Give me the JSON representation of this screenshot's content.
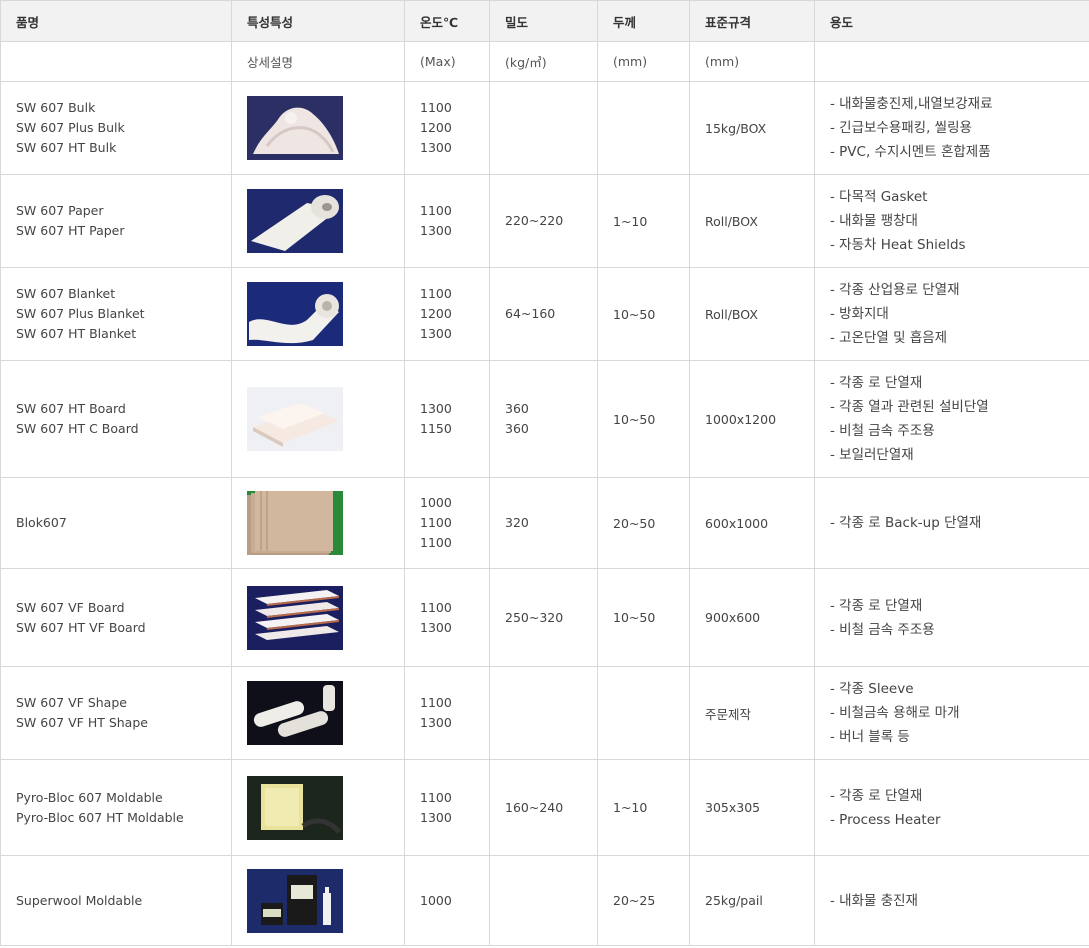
{
  "headers": [
    "품명",
    "특성특성",
    "온도℃",
    "밀도",
    "두께",
    "표준규격",
    "용도"
  ],
  "subheaders": [
    "",
    "상세설명",
    "(Max)",
    "(kg/㎥)",
    "(mm)",
    "(mm)",
    ""
  ],
  "rows": [
    {
      "names": [
        "SW 607 Bulk",
        "SW 607 Plus Bulk",
        "SW 607 HT Bulk"
      ],
      "image": "bulk-fiber-image",
      "temps": [
        "1100",
        "1200",
        "1300"
      ],
      "density": [],
      "thickness": "",
      "spec": "15kg/BOX",
      "uses": [
        "- 내화물충진제,내열보강재료",
        "- 긴급보수용패킹, 씰링용",
        "- PVC, 수지시멘트 혼합제품"
      ]
    },
    {
      "names": [
        "SW 607 Paper",
        "SW 607 HT Paper"
      ],
      "image": "paper-roll-image",
      "temps": [
        "1100",
        "1300"
      ],
      "density": [
        "220~220"
      ],
      "thickness": "1~10",
      "spec": "Roll/BOX",
      "uses": [
        "- 다목적 Gasket",
        "- 내화물 팽창대",
        "- 자동차 Heat Shields"
      ]
    },
    {
      "names": [
        "SW 607 Blanket",
        "SW 607 Plus Blanket",
        "SW 607 HT Blanket"
      ],
      "image": "blanket-roll-image",
      "temps": [
        "1100",
        "1200",
        "1300"
      ],
      "density": [
        "64~160"
      ],
      "thickness": "10~50",
      "spec": "Roll/BOX",
      "uses": [
        "- 각종 산업용로 단열재",
        "- 방화지대",
        "- 고온단열 및 흡음제"
      ]
    },
    {
      "names": [
        "SW 607 HT Board",
        "SW 607 HT C Board"
      ],
      "image": "board-sheets-image",
      "temps": [
        "1300",
        "1150"
      ],
      "density": [
        "360",
        "360"
      ],
      "thickness": "10~50",
      "spec": "1000x1200",
      "uses": [
        "- 각종 로 단열재",
        "- 각종 열과 관련된 설비단열",
        "- 비철 금속 주조용",
        "- 보일러단열재"
      ]
    },
    {
      "names": [
        "Blok607"
      ],
      "image": "blok-panels-image",
      "temps": [
        "1000",
        "1100",
        "1100"
      ],
      "density": [
        "320"
      ],
      "thickness": "20~50",
      "spec": "600x1000",
      "uses": [
        "- 각종 로 Back-up 단열재"
      ]
    },
    {
      "names": [
        "SW 607 VF Board",
        "SW 607 HT VF Board"
      ],
      "image": "vf-board-stack-image",
      "temps": [
        "1100",
        "1300"
      ],
      "density": [
        "250~320"
      ],
      "thickness": "10~50",
      "spec": "900x600",
      "uses": [
        "- 각종 로 단열재",
        "- 비철 금속 주조용"
      ]
    },
    {
      "names": [
        "SW 607 VF Shape",
        "SW 607 VF HT Shape"
      ],
      "image": "vf-shape-tubes-image",
      "temps": [
        "1100",
        "1300"
      ],
      "density": [],
      "thickness": "",
      "spec": "주문제작",
      "uses": [
        "- 각종 Sleeve",
        "- 비철금속 용해로 마개",
        "- 버너 블록 등"
      ]
    },
    {
      "names": [
        "Pyro-Bloc 607 Moldable",
        "Pyro-Bloc 607 HT Moldable"
      ],
      "image": "pyro-bloc-image",
      "temps": [
        "1100",
        "1300"
      ],
      "density": [
        "160~240"
      ],
      "thickness": "1~10",
      "spec": "305x305",
      "uses": [
        "- 각종 로 단열재",
        "- Process Heater"
      ]
    },
    {
      "names": [
        "Superwool Moldable"
      ],
      "image": "moldable-containers-image",
      "temps": [
        "1000"
      ],
      "density": [],
      "thickness": "20~25",
      "spec": "25kg/pail",
      "uses": [
        "- 내화물 충진재"
      ]
    }
  ]
}
